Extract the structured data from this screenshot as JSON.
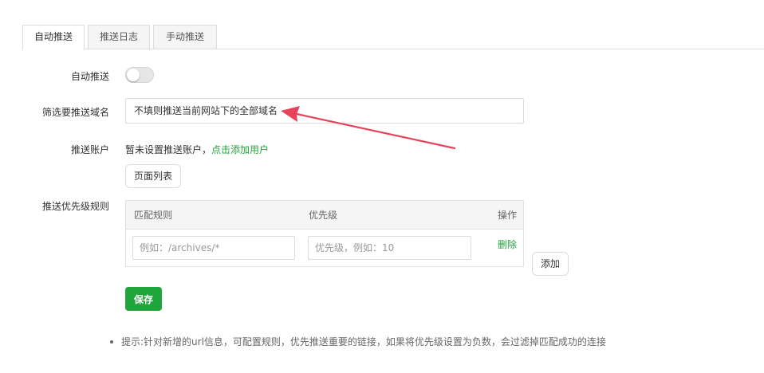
{
  "tabs": [
    {
      "label": "自动推送",
      "active": true
    },
    {
      "label": "推送日志",
      "active": false
    },
    {
      "label": "手动推送",
      "active": false
    }
  ],
  "form": {
    "auto_push_label": "自动推送",
    "auto_push_on": false,
    "domain_label": "筛选要推送域名",
    "domain_placeholder": "不填则推送当前网站下的全部域名",
    "account_label": "推送账户",
    "account_text": "暂未设置推送账户，",
    "account_link": "点击添加用户",
    "page_list_button": "页面列表",
    "priority_label": "推送优先级规则"
  },
  "rules_table": {
    "headers": [
      "匹配规则",
      "优先级",
      "操作"
    ],
    "rows": [
      {
        "match_placeholder": "例如：/archives/*",
        "priority_placeholder": "优先级，例如：10",
        "action": "删除"
      }
    ]
  },
  "add_button": "添加",
  "save_button": "保存",
  "tip": "提示:针对新增的url信息，可配置规则，优先推送重要的链接，如果将优先级设置为负数，会过滤掉匹配成功的连接",
  "colors": {
    "accent": "#20a53a",
    "annotation_arrow": "#e8435a"
  }
}
